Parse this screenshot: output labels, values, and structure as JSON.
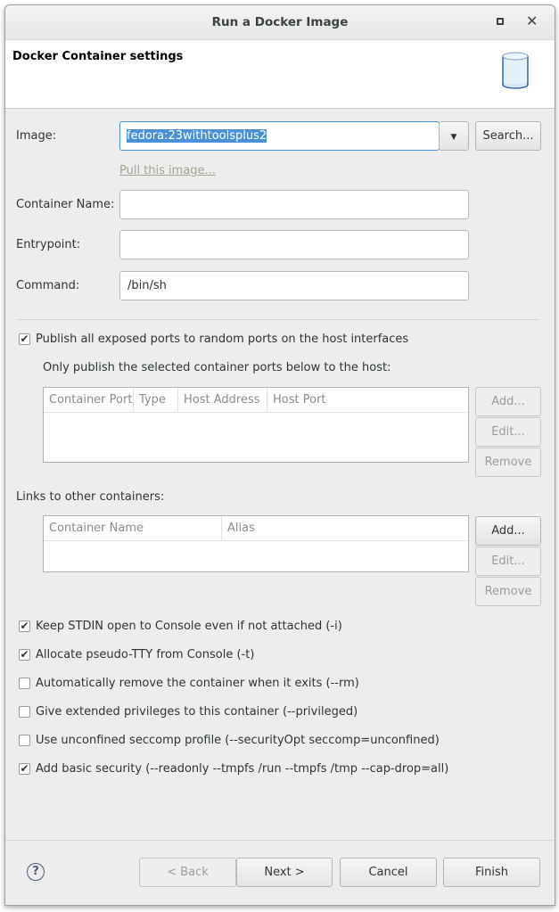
{
  "window": {
    "title": "Run a Docker Image"
  },
  "header": {
    "title": "Docker Container settings"
  },
  "image": {
    "label": "Image:",
    "value": "fedora:23withtoolsplus2",
    "search": "Search...",
    "pull_link": "Pull this image..."
  },
  "container_name": {
    "label": "Container Name:",
    "value": ""
  },
  "entrypoint": {
    "label": "Entrypoint:",
    "value": ""
  },
  "command": {
    "label": "Command:",
    "value": "/bin/sh"
  },
  "publish_all": {
    "label": "Publish all exposed ports to random ports on the host interfaces",
    "checked": true
  },
  "ports": {
    "label": "Only publish the selected container ports below to the host:",
    "columns": [
      "Container Port",
      "Type",
      "Host Address",
      "Host Port"
    ],
    "add": "Add...",
    "edit": "Edit...",
    "remove": "Remove"
  },
  "links": {
    "label": "Links to other containers:",
    "columns": [
      "Container Name",
      "Alias"
    ],
    "add": "Add...",
    "edit": "Edit...",
    "remove": "Remove"
  },
  "options": [
    {
      "label": "Keep STDIN open to Console even if not attached (-i)",
      "checked": true
    },
    {
      "label": "Allocate pseudo-TTY from Console (-t)",
      "checked": true
    },
    {
      "label": "Automatically remove the container when it exits (--rm)",
      "checked": false
    },
    {
      "label": "Give extended privileges to this container (--privileged)",
      "checked": false
    },
    {
      "label": "Use unconfined seccomp profile (--securityOpt seccomp=unconfined)",
      "checked": false
    },
    {
      "label": "Add basic security (--readonly --tmpfs /run --tmpfs /tmp --cap-drop=all)",
      "checked": true
    }
  ],
  "footer": {
    "back": "< Back",
    "next": "Next >",
    "cancel": "Cancel",
    "finish": "Finish"
  }
}
